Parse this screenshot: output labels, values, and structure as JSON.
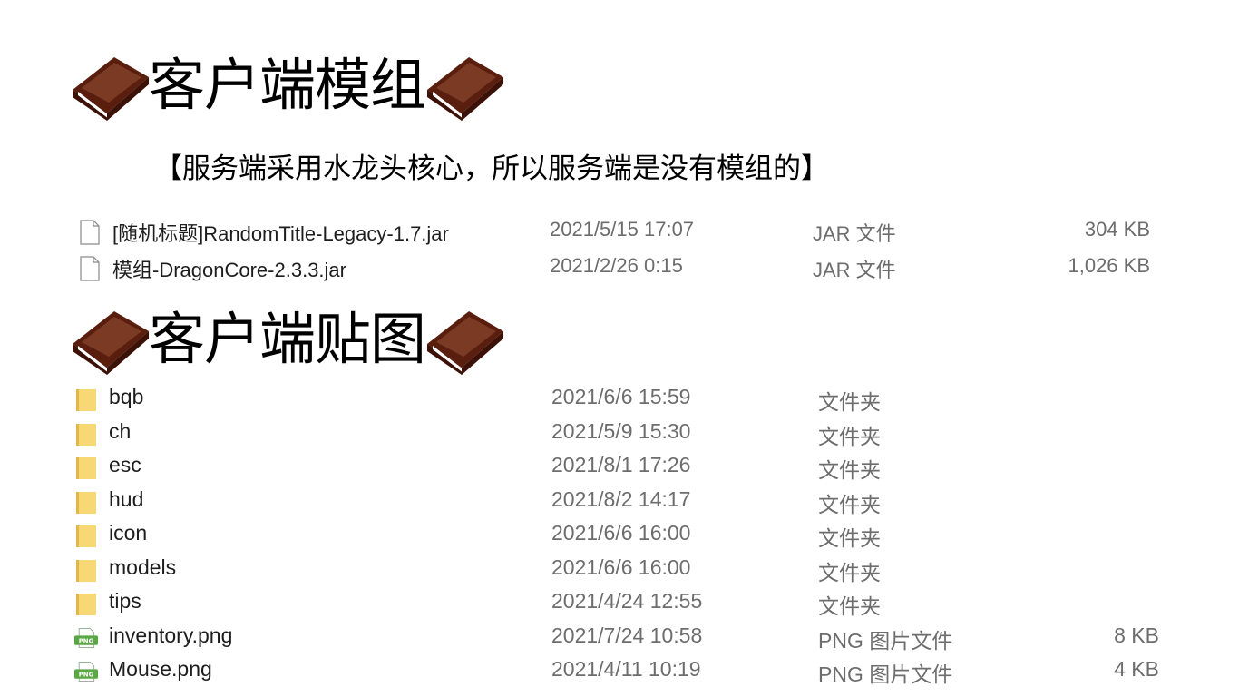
{
  "sections": {
    "mods": {
      "title": "客户端模组",
      "note": "【服务端采用水龙头核心，所以服务端是没有模组的】",
      "files": [
        {
          "name": "[随机标题]RandomTitle-Legacy-1.7.jar",
          "modified": "2021/5/15 17:07",
          "type": "JAR 文件",
          "size": "304 KB",
          "icon": "file-icon"
        },
        {
          "name": "模组-DragonCore-2.3.3.jar",
          "modified": "2021/2/26 0:15",
          "type": "JAR 文件",
          "size": "1,026 KB",
          "icon": "file-icon"
        }
      ]
    },
    "textures": {
      "title": "客户端贴图",
      "files": [
        {
          "name": "bqb",
          "modified": "2021/6/6 15:59",
          "type": "文件夹",
          "size": "",
          "icon": "folder-icon"
        },
        {
          "name": "ch",
          "modified": "2021/5/9 15:30",
          "type": "文件夹",
          "size": "",
          "icon": "folder-icon"
        },
        {
          "name": "esc",
          "modified": "2021/8/1 17:26",
          "type": "文件夹",
          "size": "",
          "icon": "folder-icon"
        },
        {
          "name": "hud",
          "modified": "2021/8/2 14:17",
          "type": "文件夹",
          "size": "",
          "icon": "folder-icon"
        },
        {
          "name": "icon",
          "modified": "2021/6/6 16:00",
          "type": "文件夹",
          "size": "",
          "icon": "folder-icon"
        },
        {
          "name": "models",
          "modified": "2021/6/6 16:00",
          "type": "文件夹",
          "size": "",
          "icon": "folder-icon"
        },
        {
          "name": "tips",
          "modified": "2021/4/24 12:55",
          "type": "文件夹",
          "size": "",
          "icon": "folder-icon"
        },
        {
          "name": "inventory.png",
          "modified": "2021/7/24 10:58",
          "type": "PNG 图片文件",
          "size": "8 KB",
          "icon": "png-icon"
        },
        {
          "name": "Mouse.png",
          "modified": "2021/4/11 10:19",
          "type": "PNG 图片文件",
          "size": "4 KB",
          "icon": "png-icon"
        }
      ]
    }
  },
  "colors": {
    "book_cover": "#5a1e0e",
    "book_cover_light": "#7a3a24",
    "book_pages": "#ffffff",
    "folder": "#f8d775",
    "folder_dark": "#e0b84a",
    "png_badge": "#5aa845"
  }
}
